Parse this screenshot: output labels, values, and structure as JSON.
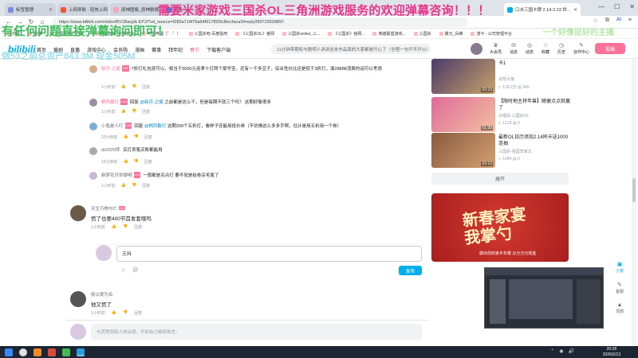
{
  "browser": {
    "tabs": [
      {
        "label": "标签管理",
        "color": "#7b8cde",
        "active": false
      },
      {
        "label": "上网导航 · 轻快上网 从这里开始",
        "color": "#e9573f",
        "active": false
      },
      {
        "label": "原神图像_原神剧情",
        "color": "#f4a7c3",
        "active": false
      },
      {
        "label": "百科",
        "color": "#3b82f6",
        "active": false
      },
      {
        "label": "口水三国卡牌 2.14-2.23 世...",
        "color": "#00aeec",
        "active": true
      }
    ],
    "url": "https://www.bilibili.com/video/BV1Bacjzb EPJ/?vd_source=f283a714f76a64f617f920cfbccfaca3#reply289723528897",
    "ai_label": "AI"
  },
  "bookmarks": [
    "鸿蒙",
    "微博",
    "三国杀官方正版...",
    "游戏直播_全部游戏",
    "哔哩哔哩（゜-゜）",
    "三国杀吧-百度贴吧",
    "《三国杀OL》官网",
    "三国杀online_三...",
    "《三国杀》官网...",
    "英雄联盟游戏...",
    "三国杀",
    "聚元_兵推",
    "游卡 - 公司管理平台"
  ],
  "site": {
    "logo": "bilibili",
    "nav": [
      "首页",
      "番剧",
      "直播",
      "游戏中心",
      "会员购",
      "漫画",
      "赛事",
      "拜年纪",
      "春节",
      "下载客户端"
    ],
    "search_placeholder": "11分钟带期权与聪明人讲讲这本作品真的大家都是开心了（全程一句开不开11）",
    "top_icons": [
      {
        "icon": "crown-icon",
        "label": "大会员"
      },
      {
        "icon": "message-icon",
        "label": "消息"
      },
      {
        "icon": "dynamic-icon",
        "label": "动态"
      },
      {
        "icon": "star-icon",
        "label": "收藏"
      },
      {
        "icon": "history-icon",
        "label": "历史"
      },
      {
        "icon": "bulb-icon",
        "label": "创作中心"
      }
    ],
    "upload": "投稿"
  },
  "overlays": {
    "line1": "需要米家游戏三国杀OL三角洲游戏服务的欢迎弹幕咨询！！！",
    "line2": "有任何问题直接弹幕询问即可！",
    "line3": "做53之前总资产843.3M 现金505M",
    "line4": "一个好像挺好的主播"
  },
  "comments": {
    "replies": [
      {
        "user": "新月-之痕",
        "lv": "LV6",
        "text": "7折灯礼包就可以，相当于5000元连拿十灯两个豪华宝，还有一千多豆子，综合性价比还是低于3折灯，凑28888消费的话可以考虑",
        "time": "1小时前",
        "likes": "",
        "color": "#d4b08a"
      },
      {
        "user": "桐风散灯",
        "lv": "LV5",
        "reply_to": "@新月-之痕",
        "text": "之前都是这么干，但是每期不就三个吗？ 这期好像很多",
        "time": "1小时前",
        "likes": "",
        "color": "#9a8ea3"
      },
      {
        "user": "小兔是人叮",
        "lv": "LV5",
        "reply_to": "@桐风散灯",
        "text": "这期200个五折灯，看样子还能用抵价券（不仿佛这么多多手啊，估计是用五折用一个券）",
        "time": "22分钟前",
        "likes": "",
        "color": "#7ab0d8"
      },
      {
        "user": "dz2025呼",
        "lv": "",
        "text": "买灯卖笔买账都能用",
        "time": "16分钟前",
        "likes": "",
        "color": "#aaaaaa"
      },
      {
        "user": "新梦花开到黎明",
        "lv": "LV4",
        "text": "一般都是买点灯 要不就是给卷买毛笔了",
        "time": "1小时前",
        "likes": "",
        "color": "#c9b6d8"
      }
    ],
    "comment1": {
      "user": "天生万物与仁",
      "lv": "LV4",
      "text": "慌了也要400节首发套哦吗",
      "time": "1小时前",
      "color": "#6b5a48"
    },
    "reply_input": "三抖",
    "reply_input_placeholder": "",
    "send": "发布",
    "comment2": {
      "user": "别以爱为名",
      "text": "他又慌了",
      "time": "1小时前",
      "color": "#555"
    },
    "reply_action": "回复",
    "bottom_placeholder": "与其赞同别人的话语，不如自己畅所欲言。"
  },
  "related": [
    {
      "title": "卡1",
      "up": "会帮大凝",
      "plays": "129.2万",
      "comments": "945",
      "dur": "02:23",
      "c1": "#4a3a6a",
      "c2": "#c9a16a"
    },
    {
      "title": "【限时地主将年兽】随便点点就赢了",
      "up": "白哩哥-三国杀OL",
      "plays": "1219",
      "comments": "0",
      "dur": "01:39",
      "c1": "#e06a9a",
      "c2": "#f3c0a0"
    },
    {
      "title": "最新OL日历添加2.14同卡送1000连抽",
      "up": "三国杀-祖国李家文",
      "plays": "1049",
      "comments": "0",
      "dur": "02:12",
      "c1": "#8a5a40",
      "c2": "#d4a070"
    }
  ],
  "expand": "展开",
  "ad": {
    "title": "新春家宴\n我掌勺",
    "sub": "做出你的家乡年菜 瓜分万元现金"
  },
  "sidefloat": [
    {
      "icon": "tv-icon",
      "label": "小窗"
    },
    {
      "icon": "pencil-icon",
      "label": "客服"
    },
    {
      "icon": "up-icon",
      "label": "顶部"
    }
  ],
  "taskbar": {
    "time": "20:28",
    "date": "2026/2/13"
  }
}
